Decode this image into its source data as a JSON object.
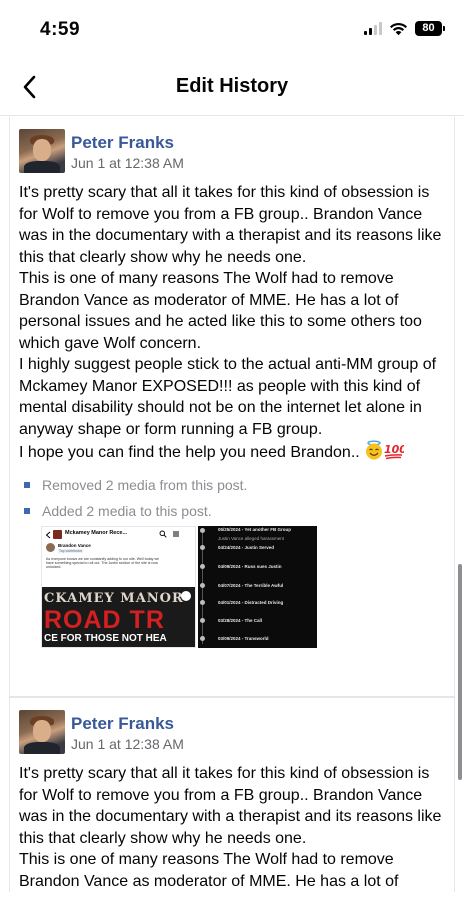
{
  "status_bar": {
    "time": "4:59",
    "battery": "80"
  },
  "nav": {
    "title": "Edit History"
  },
  "entries": [
    {
      "author": "Peter Franks",
      "time": "Jun 1 at 12:38 AM",
      "text": "It's pretty scary that all it takes for this kind of obsession is for Wolf to remove you from a FB group.. Brandon Vance was in the documentary with a therapist and its reasons like this that clearly show why he needs one.\nThis is one of many reasons The Wolf had to remove Brandon Vance as moderator of MME. He has a lot of personal issues and he acted like this to some others too which gave Wolf concern.\nI highly suggest people stick to the actual anti-MM group of Mckamey Manor EXPOSED!!! as people with this kind of mental disability should not be on the internet let alone in anyway shape or form running a FB group.\nI hope you can find the help you need Brandon..",
      "changes": [
        "Removed 2 media from this post.",
        "Added 2 media to this post."
      ]
    },
    {
      "author": "Peter Franks",
      "time": "Jun 1 at 12:38 AM",
      "text": "It's pretty scary that all it takes for this kind of obsession is for Wolf to remove you from a FB group.. Brandon Vance was in the documentary with a therapist and its reasons like this that clearly show why he needs one.\nThis is one of many reasons The Wolf had to remove Brandon Vance as moderator of MME. He has a lot of"
    }
  ],
  "media_a": {
    "title": "Mckamey Manor Rece...",
    "author": "Brandon Vance",
    "badge": "Top contributor",
    "body": "As everyone knows we are constantly adding to our site. Well today we have something special to roll out. The Justin section of the site is now unlocked.",
    "promo_line1": "CKAMEY MANOR",
    "promo_line2": "ROAD TR",
    "promo_line3": "CE FOR THOSE NOT HEA"
  },
  "media_b": {
    "items": [
      "05/25/2024 - Yet another FB Group",
      "Justin Vance alleged harassment",
      "04/24/2024 - Justin Served",
      "04/09/2024 - Russ sues Justin",
      "04/07/2024 - The Terrible Awful",
      "04/01/2024 - Distracted Driving",
      "03/28/2024 - The Call",
      "03/09/2024 - Transworld"
    ]
  },
  "colors": {
    "link": "#385898",
    "meta": "#65676b",
    "bullet": "#4267b2"
  }
}
